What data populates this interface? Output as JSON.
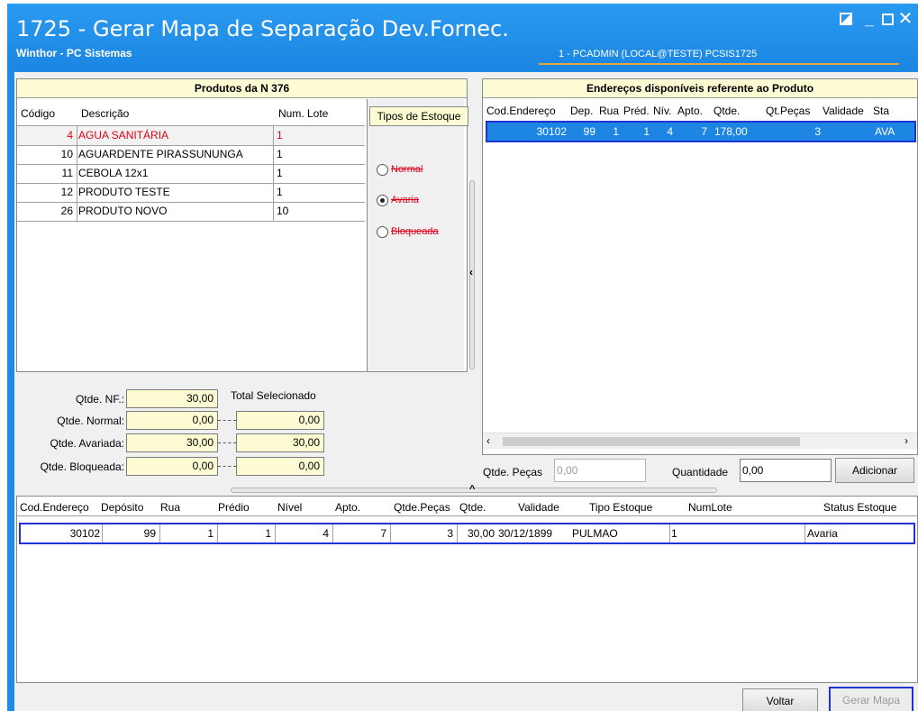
{
  "window": {
    "title": "1725 - Gerar Mapa de Separação Dev.Fornec.",
    "subtitle": "Winthor - PC Sistemas",
    "user_info": "1 - PCADMIN (LOCAL@TESTE)  PCSIS1725"
  },
  "products": {
    "caption": "Produtos da N 376",
    "columns": [
      "Código",
      "Descrição",
      "Num. Lote"
    ],
    "rows": [
      {
        "codigo": "4",
        "descricao": "AGUA SANITÁRIA",
        "lote": "1",
        "selected": true
      },
      {
        "codigo": "10",
        "descricao": "AGUARDENTE PIRASSUNUNGA",
        "lote": "1"
      },
      {
        "codigo": "11",
        "descricao": "CEBOLA 12x1",
        "lote": "1"
      },
      {
        "codigo": "12",
        "descricao": "PRODUTO TESTE",
        "lote": "1"
      },
      {
        "codigo": "26",
        "descricao": "PRODUTO NOVO",
        "lote": "10"
      }
    ]
  },
  "stock_types": {
    "title": "Tipos de Estoque",
    "options": [
      {
        "label": "Normal",
        "checked": false
      },
      {
        "label": "Avaria",
        "checked": true
      },
      {
        "label": "Bloqueada",
        "checked": false
      }
    ]
  },
  "totals": {
    "total_selecionado_label": "Total Selecionado",
    "nf_label": "Qtde. NF.:",
    "nf_value": "30,00",
    "normal_label": "Qtde. Normal:",
    "normal_value": "0,00",
    "normal_total": "0,00",
    "avariada_label": "Qtde. Avariada:",
    "avariada_value": "30,00",
    "avariada_total": "30,00",
    "bloqueada_label": "Qtde. Bloqueada:",
    "bloqueada_value": "0,00",
    "bloqueada_total": "0,00"
  },
  "addresses": {
    "caption": "Endereços disponíveis referente ao Produto",
    "columns": [
      "Cod.Endereço",
      "Dep.",
      "Rua",
      "Préd.",
      "Nív.",
      "Apto.",
      "Qtde.",
      "Qt.Peças",
      "Validade",
      "Sta"
    ],
    "rows": [
      {
        "cod": "30102",
        "dep": "99",
        "rua": "1",
        "pred": "1",
        "niv": "4",
        "apto": "7",
        "qtde": "178,00",
        "pecas": "3",
        "validade": "",
        "status": "AVA"
      }
    ],
    "pecas_label": "Qtde. Peças",
    "pecas_value": "0,00",
    "quantidade_label": "Quantidade",
    "quantidade_value": "0,00",
    "add_button": "Adicionar"
  },
  "bottom_grid": {
    "columns": [
      "Cod.Endereço",
      "Depósito",
      "Rua",
      "Prédio",
      "Nível",
      "Apto.",
      "Qtde.Peças",
      "Qtde.",
      "Validade",
      "Tipo Estoque",
      "NumLote",
      "Status Estoque"
    ],
    "rows": [
      {
        "cod": "30102",
        "deposito": "99",
        "rua": "1",
        "predio": "1",
        "nivel": "4",
        "apto": "7",
        "pecas": "3",
        "qtde": "30,00",
        "validade": "30/12/1899",
        "tipo": "PULMAO",
        "lote": "1",
        "status": "Avaria"
      }
    ]
  },
  "footer": {
    "voltar": "Voltar",
    "gerar": "Gerar Mapa"
  },
  "colors": {
    "title_bar": "#1e8be6",
    "caption_bg": "#fdfbd3",
    "selected_row": "#1c86e2",
    "focus_border": "#1f33d6",
    "error_red": "#e0001a"
  }
}
